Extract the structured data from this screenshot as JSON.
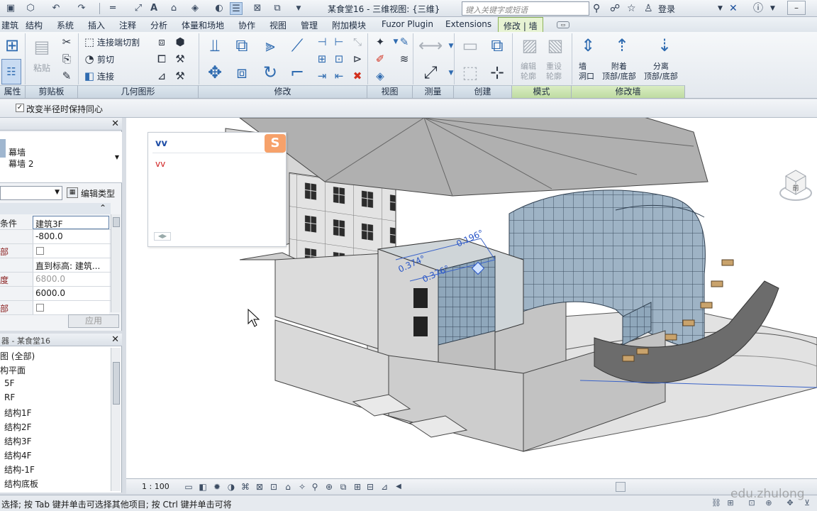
{
  "window": {
    "title": "某食堂16 - 三维视图: {三维}",
    "search_placeholder": "键入关键字或短语",
    "login": "登录"
  },
  "tabs": [
    "建筑",
    "结构",
    "系统",
    "插入",
    "注释",
    "分析",
    "体量和场地",
    "协作",
    "视图",
    "管理",
    "附加模块",
    "Fuzor Plugin",
    "Extensions",
    "修改 | 墙"
  ],
  "ribbon": {
    "paste_label": "粘贴",
    "geometry_items": [
      "连接端切割",
      "剪切",
      "连接"
    ],
    "modify_wall": {
      "edit_profile": "编辑\n轮廓",
      "reset_profile": "重设\n轮廓",
      "wall_opening": "墙\n洞口",
      "attach": "附着\n顶部/底部",
      "detach": "分离\n顶部/底部"
    },
    "panels": [
      "属性",
      "剪贴板",
      "几何图形",
      "修改",
      "视图",
      "测量",
      "创建",
      "模式",
      "修改墙"
    ]
  },
  "options_bar": {
    "checkbox_label": "改变半径时保持同心",
    "checked": true
  },
  "properties": {
    "type_name": "幕墙",
    "type_sub": "幕墙 2",
    "edit_type": "编辑类型",
    "group_toggle": "⌃",
    "rows": [
      {
        "label": "条件",
        "value": "建筑3F",
        "boxed": true
      },
      {
        "label": "",
        "value": "-800.0"
      },
      {
        "label": "部",
        "value": "",
        "checkbox": true
      },
      {
        "label": "",
        "value": "直到标高: 建筑..."
      },
      {
        "label": "度",
        "value": "6800.0",
        "grayed": true
      },
      {
        "label": "",
        "value": "6000.0"
      },
      {
        "label": "部",
        "value": "",
        "checkbox": true
      }
    ],
    "apply": "应用"
  },
  "browser": {
    "title": "器 - 某食堂16",
    "items": [
      "图 (全部)",
      "构平面",
      "5F",
      "RF",
      "结构1F",
      "结构2F",
      "结构3F",
      "结构4F",
      "结构-1F",
      "结构底板"
    ]
  },
  "ime": {
    "input": "vv",
    "candidate": "vv",
    "logo": "S"
  },
  "viewport": {
    "angles": [
      "0.196°",
      "0.374°",
      "0.376°"
    ],
    "viewcube_face": "前"
  },
  "view_bar": {
    "scale": "1 : 100"
  },
  "status": {
    "text": "选择; 按 Tab 键并单击可选择其他项目; 按 Ctrl 键并单击可将",
    "watermark": "edu.zhulong"
  }
}
